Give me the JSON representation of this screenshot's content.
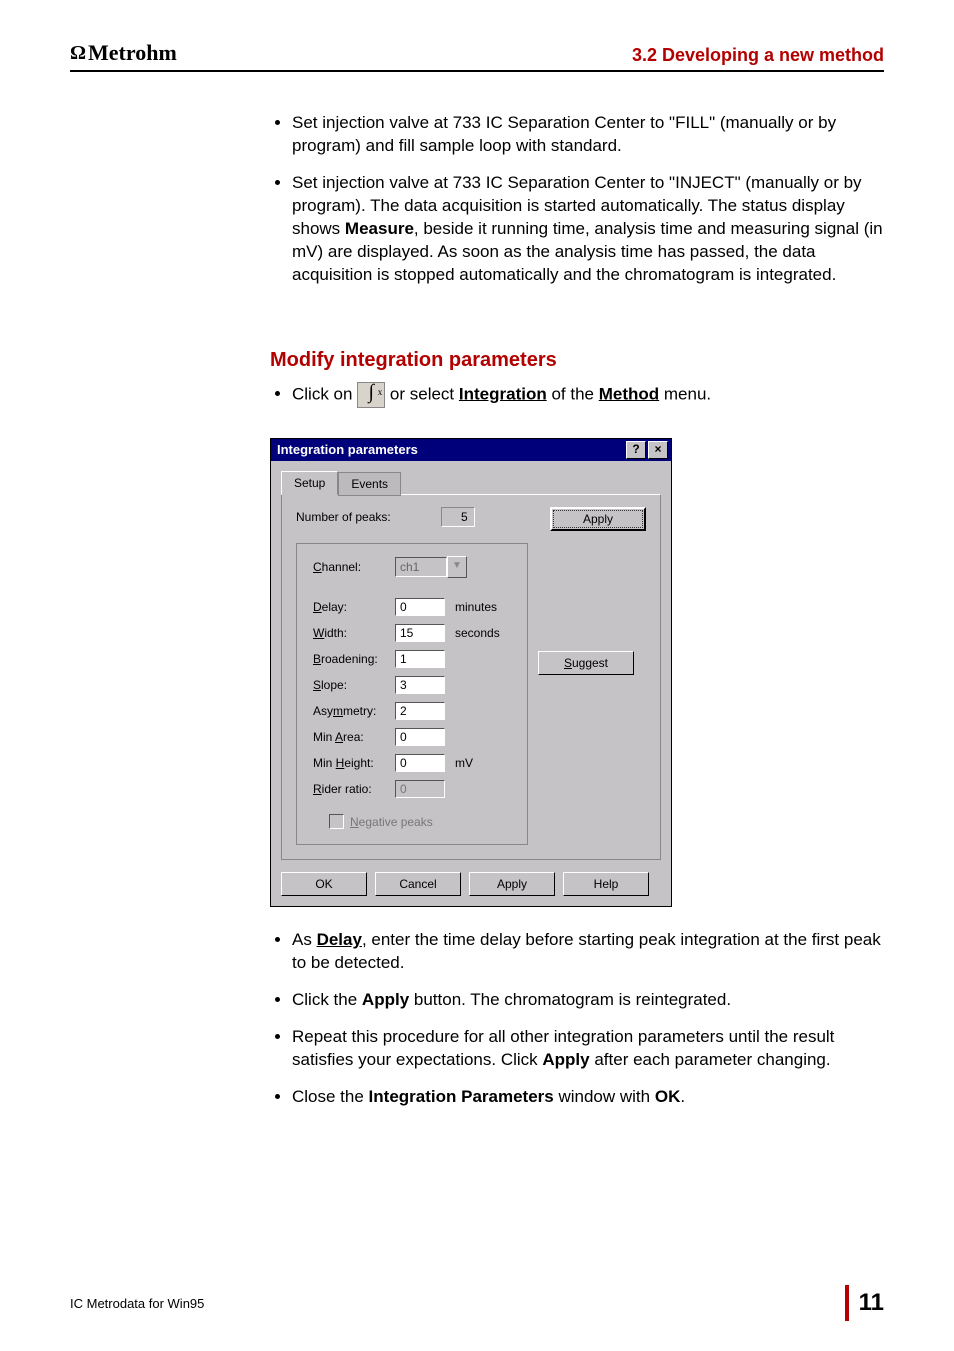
{
  "header": {
    "logo": "Metrohm",
    "section_title": "3.2  Developing a new method"
  },
  "intro_bullets": [
    "Set injection valve at 733 IC Separation Center to \"FILL\" (manually or by program) and fill sample loop with standard.",
    "Set injection valve at 733 IC Separation Center to \"INJECT\" (manually or by program). The data acquisition is started automatically. The status display shows "
  ],
  "intro_b2_measure": "Measure",
  "intro_b2_rest": ", beside it running time, analysis time and measuring signal (in mV) are displayed. As soon as the analysis time has passed, the data acquisition is stopped automatically and the chromatogram is integrated.",
  "section2_heading": "Modify integration parameters",
  "click_on": "Click on ",
  "or_select": " or select ",
  "integration_lbl": "Integration",
  "of_the": " of the ",
  "method_lbl": "Method",
  "menu_period": " menu.",
  "dialog": {
    "title": "Integration parameters",
    "help_btn": "?",
    "close_btn": "×",
    "tabs": {
      "setup": "Setup",
      "events": "Events"
    },
    "num_peaks_label": "Number of peaks:",
    "num_peaks_value": "5",
    "apply_btn": "Apply",
    "channel_label": "Channel:",
    "channel_value": "ch1",
    "fields": {
      "delay": {
        "label": "Delay:",
        "value": "0",
        "unit": "minutes"
      },
      "width": {
        "label": "Width:",
        "value": "15",
        "unit": "seconds"
      },
      "broadening": {
        "label": "Broadening:",
        "value": "1",
        "unit": ""
      },
      "slope": {
        "label": "Slope:",
        "value": "3",
        "unit": ""
      },
      "asymmetry": {
        "label": "Asymmetry:",
        "value": "2",
        "unit": ""
      },
      "minarea": {
        "label": "Min Area:",
        "value": "0",
        "unit": ""
      },
      "minheight": {
        "label": "Min Height:",
        "value": "0",
        "unit": "mV"
      },
      "riderratio": {
        "label": "Rider ratio:",
        "value": "0",
        "unit": ""
      }
    },
    "suggest_btn": "Suggest",
    "neg_peaks": "Negative peaks",
    "ok": "OK",
    "cancel": "Cancel",
    "apply2": "Apply",
    "help": "Help"
  },
  "post_bullets": {
    "b1_a": "As ",
    "b1_delay": "Delay",
    "b1_b": ", enter the time delay before starting peak integration at the first peak to be detected.",
    "b2_a": "Click the ",
    "b2_apply": "Apply",
    "b2_b": " button. The chromatogram is reintegrated.",
    "b3_a": "Repeat this procedure for all other integration parameters until the result satisfies your expectations. Click ",
    "b3_apply": "Apply",
    "b3_b": " after each parameter changing.",
    "b4_a": "Close the ",
    "b4_win": "Integration Parameters",
    "b4_b": " window with ",
    "b4_ok": "OK",
    "b4_c": "."
  },
  "footer": {
    "left": "IC Metrodata for Win95",
    "page": "11"
  }
}
